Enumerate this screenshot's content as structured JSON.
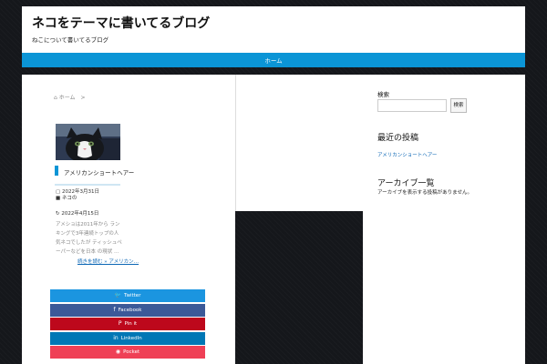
{
  "header": {
    "site_title": "ネコをテーマに書いてるブログ",
    "site_description": "ねこについて書いてるブログ"
  },
  "nav": {
    "home_label": "ホーム"
  },
  "breadcrumb": {
    "home": "ホーム",
    "separator": ">"
  },
  "post": {
    "title": "アメリカンショートヘアー",
    "published_date": "2022年3月31日",
    "category": "ネコの",
    "updated_date": "2022年4月15日",
    "excerpt": "アメショは2011年から ランキングで3年連続トップの人気ネコでしたが ティッシュペーパーなどを日本 の現状 …",
    "read_more": "続きを読む »  アメリカン…"
  },
  "share": {
    "buttons": [
      {
        "label": "Twitter",
        "icon": "twitter-icon",
        "glyph": "🐦",
        "color": "#1b95e0"
      },
      {
        "label": "Facebook",
        "icon": "facebook-icon",
        "glyph": "f",
        "color": "#3b5998"
      },
      {
        "label": "Pin it",
        "icon": "pinterest-icon",
        "glyph": "P",
        "color": "#bd081c"
      },
      {
        "label": "LinkedIn",
        "icon": "linkedin-icon",
        "glyph": "in",
        "color": "#0077b5"
      },
      {
        "label": "Pocket",
        "icon": "pocket-icon",
        "glyph": "◉",
        "color": "#ef4056"
      }
    ]
  },
  "sidebar": {
    "search_label": "検索",
    "search_button": "検索",
    "recent_heading": "最近の投稿",
    "recent_link": "アメリカンショートヘアー",
    "archive_heading": "アーカイブ一覧",
    "archive_text": "アーカイブを表示する投稿がありません。"
  },
  "colors": {
    "accent": "#0b95d6",
    "background": "#15171b"
  }
}
